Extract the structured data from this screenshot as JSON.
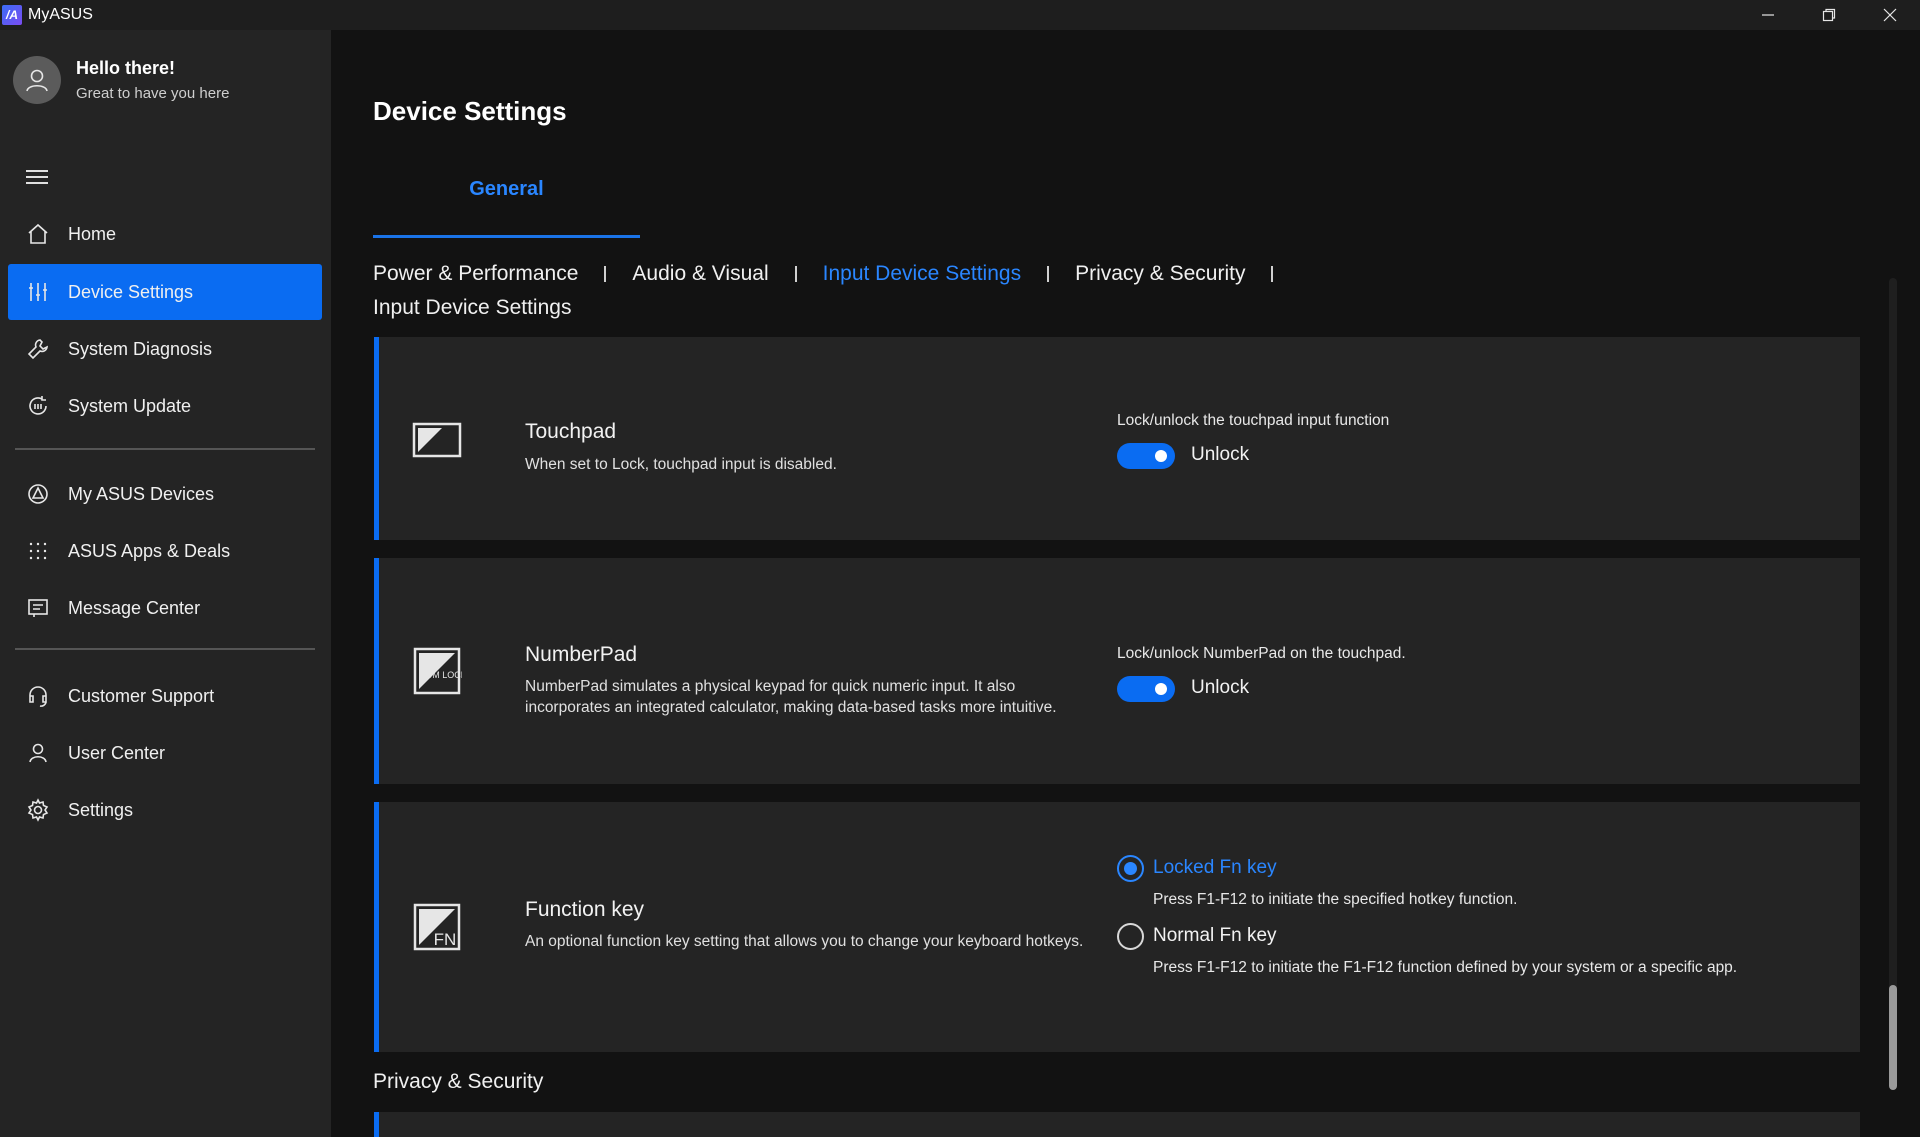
{
  "window": {
    "app_title": "MyASUS",
    "logo_text": "/A",
    "controls": [
      "minimize-icon",
      "restore-icon",
      "close-icon"
    ]
  },
  "sidebar": {
    "profile": {
      "title": "Hello there!",
      "subtitle": "Great to have you here"
    },
    "items": [
      {
        "label": "Home",
        "icon": "home-icon"
      },
      {
        "label": "Device Settings",
        "icon": "sliders-icon",
        "active": true
      },
      {
        "label": "System Diagnosis",
        "icon": "wrench-icon"
      },
      {
        "label": "System Update",
        "icon": "update-icon"
      },
      {
        "label": "My ASUS Devices",
        "icon": "devices-icon"
      },
      {
        "label": "ASUS Apps & Deals",
        "icon": "apps-grid-icon"
      },
      {
        "label": "Message Center",
        "icon": "message-icon"
      },
      {
        "label": "Customer Support",
        "icon": "headset-icon"
      },
      {
        "label": "User Center",
        "icon": "user-icon"
      },
      {
        "label": "Settings",
        "icon": "gear-icon"
      }
    ]
  },
  "main": {
    "title": "Device Settings",
    "tab": "General",
    "subtabs": [
      "Power & Performance",
      "Audio & Visual",
      "Input Device Settings",
      "Privacy & Security"
    ],
    "active_subtab": "Input Device Settings",
    "section_input": "Input Device Settings",
    "section_privacy": "Privacy & Security",
    "touchpad": {
      "name": "Touchpad",
      "desc": "When set to Lock, touchpad input is disabled.",
      "control_label": "Lock/unlock the touchpad input function",
      "state": "Unlock"
    },
    "numberpad": {
      "name": "NumberPad",
      "desc": "NumberPad simulates a physical keypad for quick numeric input. It also incorporates an integrated calculator, making data-based tasks more intuitive.",
      "control_label": "Lock/unlock NumberPad on the touchpad.",
      "state": "Unlock",
      "icon_text": "NUM LOCK"
    },
    "function_key": {
      "name": "Function key",
      "desc": "An optional function key setting that allows you to change your keyboard hotkeys.",
      "icon_text": "FN",
      "options": [
        {
          "label": "Locked Fn key",
          "desc": "Press F1-F12 to initiate the specified hotkey function.",
          "checked": true
        },
        {
          "label": "Normal Fn key",
          "desc": "Press F1-F12 to initiate the F1-F12 function defined by your system or a specific app.",
          "checked": false
        }
      ]
    }
  },
  "colors": {
    "accent": "#0a6cf2",
    "link": "#2a86ff",
    "sidebar_bg": "#242424",
    "main_bg": "#121212"
  }
}
